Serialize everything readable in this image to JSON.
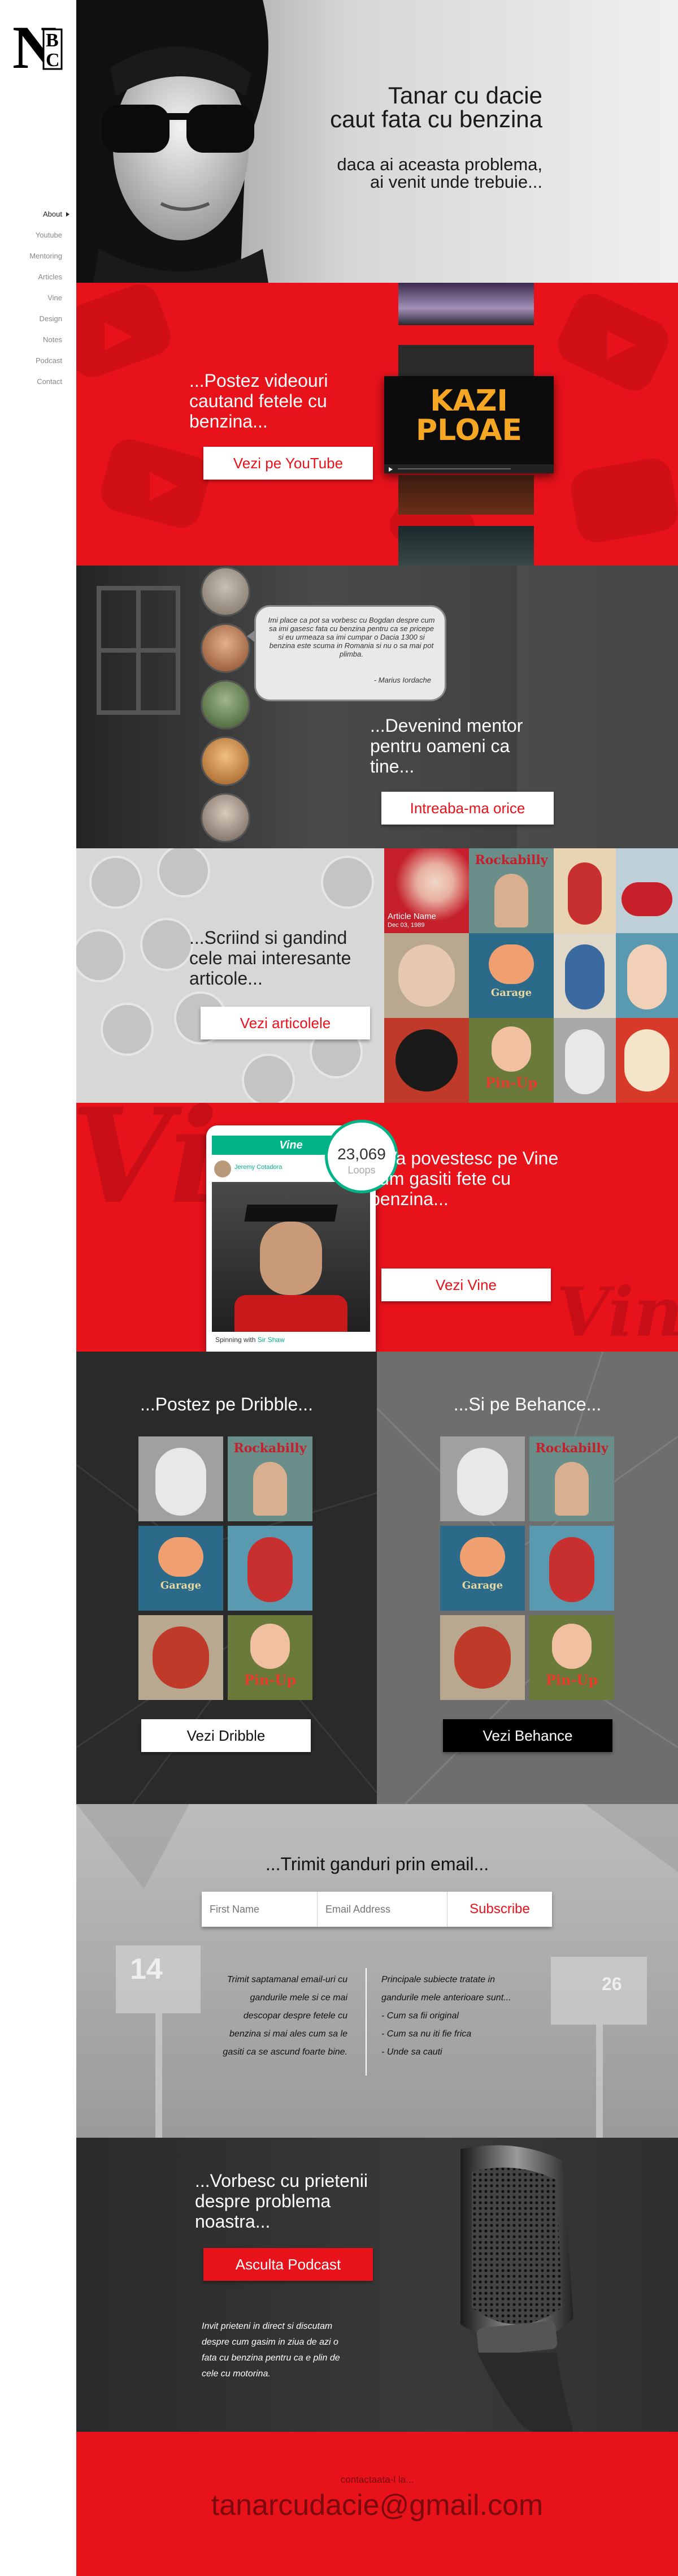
{
  "sidebar": {
    "logo_alt": "NBC",
    "items": [
      "About",
      "Youtube",
      "Mentoring",
      "Articles",
      "Vine",
      "Design",
      "Notes",
      "Podcast",
      "Contact"
    ],
    "active": "About"
  },
  "hero": {
    "title_line1": "Tanar cu dacie",
    "title_line2": "caut fata cu benzina",
    "sub_line1": "daca ai aceasta problema,",
    "sub_line2": "ai venit unde trebuie..."
  },
  "youtube": {
    "heading": "...Postez videouri cautand fetele cu benzina...",
    "button": "Vezi pe YouTube",
    "thumb_text_1": "KAZI",
    "thumb_text_2": "PLOAE"
  },
  "mentoring": {
    "quote": "Imi place ca pot sa vorbesc cu Bogdan despre cum sa imi gasesc fata cu benzina pentru ca se pricepe si eu urmeaza sa imi cumpar o Dacia 1300 si benzina este scuma in Romania si nu o sa mai pot plimba.",
    "author": "- Marius Iordache",
    "heading": "...Devenind mentor pentru oameni ca tine...",
    "button": "Intreaba-ma orice"
  },
  "articles": {
    "heading": "...Scriind si gandind cele mai interesante articole...",
    "button": "Vezi articolele",
    "article_name": "Article Name",
    "article_date": "Dec 03, 1989",
    "tile_texts": [
      "Rockabilly",
      "Pin-Up",
      "Garage",
      "Pin-Up"
    ]
  },
  "vine": {
    "heading": "...Va povestesc pe Vine cum gasiti fete cu benzina...",
    "button": "Vezi Vine",
    "loops_count": "23,069",
    "loops_label": "Loops",
    "app_name": "Vine",
    "user_name": "Jeremy Cotadora",
    "caption": "Spinning with",
    "caption_link": "Sir Shaw",
    "watermark": "Vine"
  },
  "design": {
    "dribbble_heading": "...Postez pe Dribble...",
    "dribbble_button": "Vezi Dribble",
    "behance_heading": "...Si pe Behance...",
    "behance_button": "Vezi Behance",
    "tile_texts": [
      "Rockabilly",
      "Garage",
      "Pin-Up"
    ]
  },
  "notes": {
    "heading": "...Trimit ganduri prin email...",
    "first_name_placeholder": "First Name",
    "email_placeholder": "Email Address",
    "subscribe": "Subscribe",
    "left_text": "Trimit saptamanal email-uri cu gandurile mele si ce mai descopar despre fetele cu benzina si mai ales cum sa le gasiti ca se ascund foarte bine.",
    "right_title": "Principale subiecte tratate in gandurile mele anterioare sunt...",
    "topics": [
      "- Cum sa fii original",
      "- Cum sa nu iti fie frica",
      "- Unde sa cauti"
    ],
    "mailbox_numbers": [
      "14",
      "26"
    ]
  },
  "podcast": {
    "heading": "...Vorbesc cu prietenii despre problema noastra...",
    "button": "Asculta Podcast",
    "body": "Invit prieteni in direct si discutam despre cum gasim in ziua de azi o fata cu benzina pentru ca e plin de cele cu motorina."
  },
  "contact": {
    "label": "contactaata-l la...",
    "email": "tanarcudacie@gmail.com"
  },
  "colors": {
    "red": "#e8121b",
    "dark": "#2e2e2e",
    "behance_black": "#000000"
  }
}
